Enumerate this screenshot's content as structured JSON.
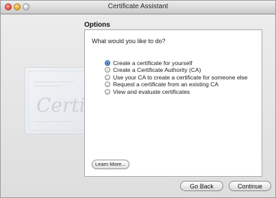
{
  "window": {
    "title": "Certificate Assistant"
  },
  "background_art": {
    "word": "Certi"
  },
  "options_section": {
    "heading": "Options",
    "question": "What would you like to do?",
    "choices": [
      {
        "label": "Create a certificate for yourself",
        "selected": true
      },
      {
        "label": "Create a Certificate Authority (CA)",
        "selected": false
      },
      {
        "label": "Use your CA to create a certificate for someone else",
        "selected": false
      },
      {
        "label": "Request a certificate from an existing CA",
        "selected": false
      },
      {
        "label": "View and evaluate certificates",
        "selected": false
      }
    ],
    "learn_more": "Learn More..."
  },
  "buttons": {
    "back": "Go Back",
    "continue": "Continue"
  }
}
